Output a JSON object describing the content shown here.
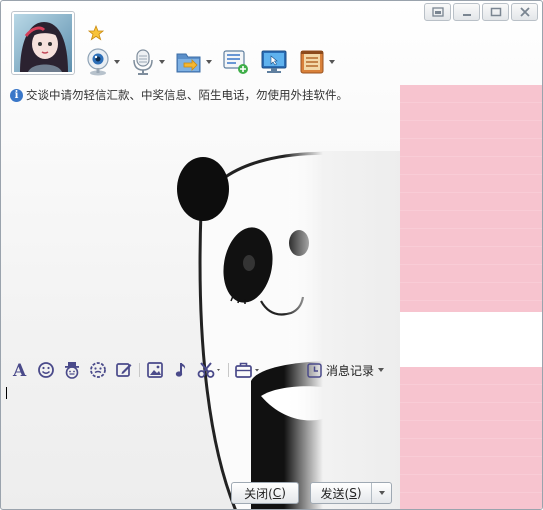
{
  "toolbar": {
    "icons": [
      "video-call-icon",
      "voice-call-icon",
      "send-file-icon",
      "create-discussion-icon",
      "remote-assistance-icon",
      "apps-icon"
    ]
  },
  "warning": {
    "text": "交谈中请勿轻信汇款、中奖信息、陌生电话，勿使用外挂软件。"
  },
  "format_bar": {
    "history_label": "消息记录"
  },
  "buttons": {
    "close_label": "关闭(",
    "close_key": "C",
    "close_end": ")",
    "send_label": "发送(",
    "send_key": "S",
    "send_end": ")"
  },
  "colors": {
    "accent": "#3a77c8",
    "panel_pink": "#f7c4cf",
    "icon_purple": "#4a4a8a"
  }
}
